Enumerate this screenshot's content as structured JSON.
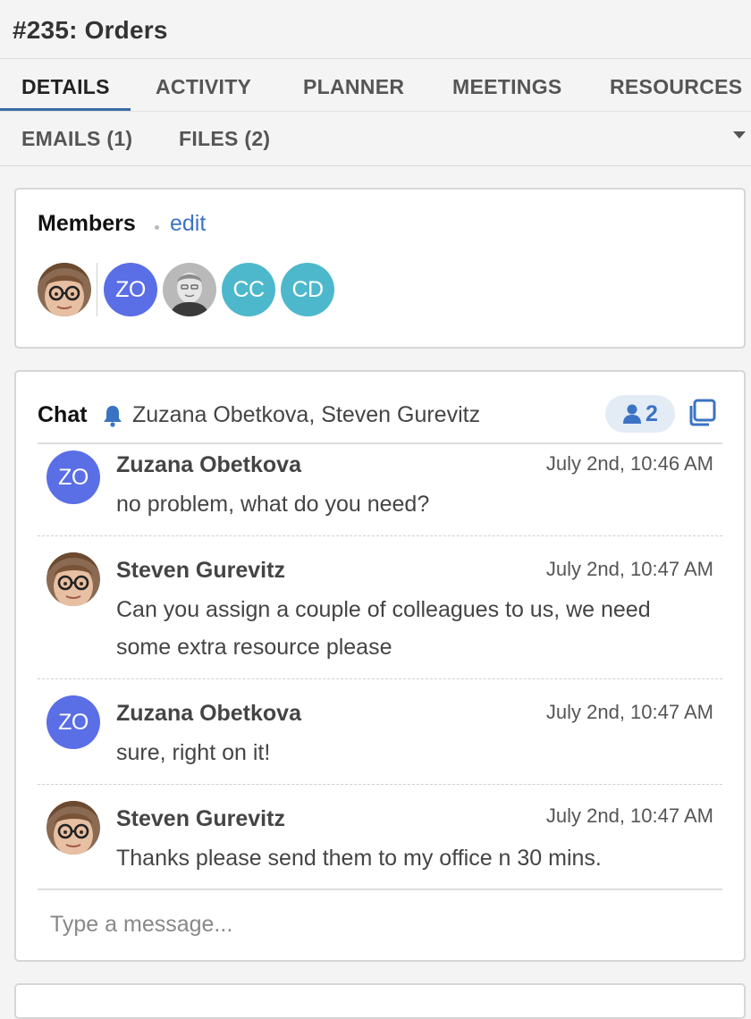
{
  "page": {
    "title": "#235: Orders"
  },
  "tabs": {
    "row1": [
      "DETAILS",
      "ACTIVITY",
      "PLANNER",
      "MEETINGS",
      "RESOURCES"
    ],
    "row2": [
      "EMAILS (1)",
      "FILES (2)"
    ],
    "active": "DETAILS"
  },
  "members": {
    "heading": "Members",
    "edit_label": "edit",
    "avatars": [
      {
        "type": "photo",
        "name": "Steven Gurevitz"
      },
      {
        "type": "initials",
        "initials": "ZO",
        "color": "#5a6ee6"
      },
      {
        "type": "photo",
        "name": "grey photo"
      },
      {
        "type": "initials",
        "initials": "CC",
        "color": "#4db8cc"
      },
      {
        "type": "initials",
        "initials": "CD",
        "color": "#4db8cc"
      }
    ]
  },
  "chat": {
    "heading": "Chat",
    "participants": "Zuzana Obetkova, Steven Gurevitz",
    "participant_count": "2",
    "accent": "#3b73c4",
    "messages": [
      {
        "sender": "Zuzana Obetkova",
        "avatar": "initials",
        "initials": "ZO",
        "time": "July 2nd, 10:46 AM",
        "text": "no problem, what do you need?"
      },
      {
        "sender": "Steven Gurevitz",
        "avatar": "photo",
        "time": "July 2nd, 10:47 AM",
        "text": "Can you assign a couple of colleagues to us, we need some extra resource please"
      },
      {
        "sender": "Zuzana Obetkova",
        "avatar": "initials",
        "initials": "ZO",
        "time": "July 2nd, 10:47 AM",
        "text": "sure, right on it!"
      },
      {
        "sender": "Steven Gurevitz",
        "avatar": "photo",
        "time": "July 2nd, 10:47 AM",
        "text": "Thanks please send them to my office n 30 mins."
      }
    ],
    "composer_placeholder": "Type a message..."
  }
}
